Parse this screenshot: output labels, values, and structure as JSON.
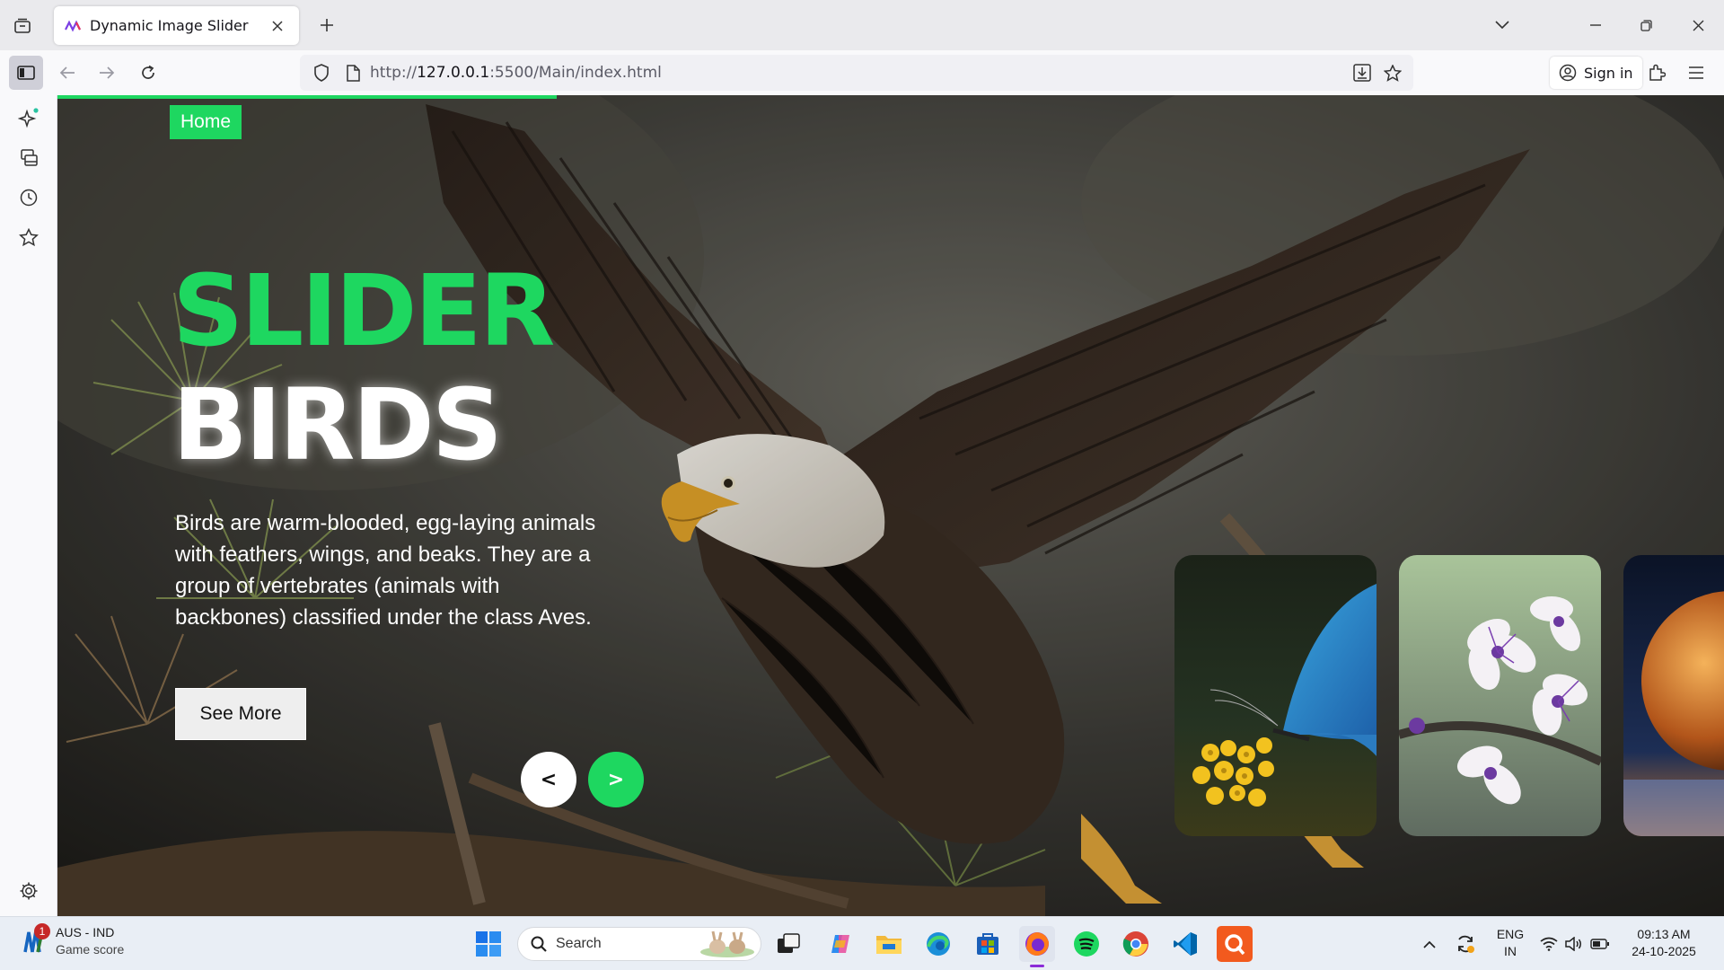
{
  "browser": {
    "tab_title": "Dynamic Image Slider",
    "url_prefix": "http://",
    "url_host": "127.0.0.1",
    "url_rest": ":5500/Main/index.html",
    "signin_label": "Sign in"
  },
  "page": {
    "nav_home": "Home",
    "title_line1": "SLIDER",
    "title_line2": "BIRDS",
    "description": "Birds are warm-blooded, egg-laying animals with feathers, wings, and beaks. They are a group of vertebrates (animals with backbones) classified under the class Aves.",
    "see_more": "See More",
    "prev_label": "<",
    "next_label": ">",
    "progress_fraction": 0.3,
    "accent_color": "#1ed760"
  },
  "thumbnails": [
    "butterfly",
    "blossoms",
    "planet"
  ],
  "taskbar": {
    "weather_title": "AUS - IND",
    "weather_sub": "Game score",
    "weather_badge": "1",
    "search_label": "Search",
    "lang_1": "ENG",
    "lang_2": "IN",
    "time": "09:13 AM",
    "date": "24-10-2025"
  }
}
